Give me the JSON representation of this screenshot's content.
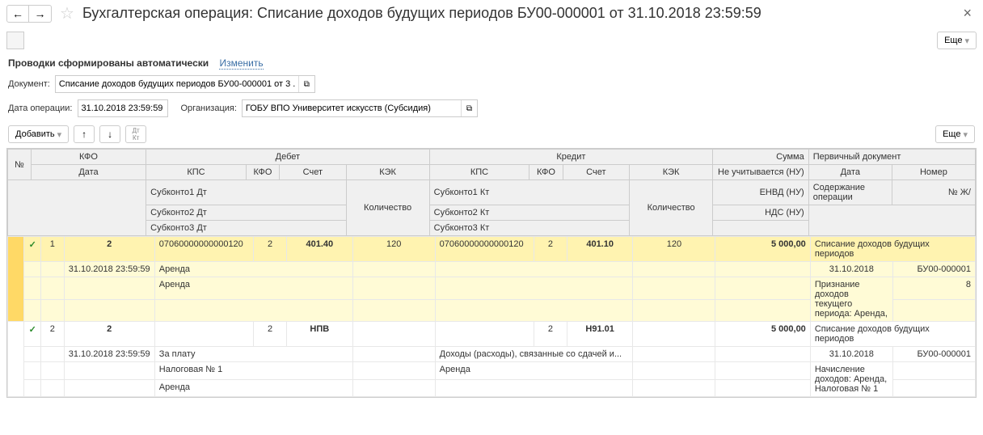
{
  "title": "Бухгалтерская операция: Списание доходов будущих периодов БУ00-000001 от 31.10.2018 23:59:59",
  "more_btn": "Еще",
  "autogen": {
    "text": "Проводки сформированы автоматически",
    "link": "Изменить"
  },
  "form": {
    "doc_label": "Документ:",
    "doc_value": "Списание доходов будущих периодов БУ00-000001 от 3 ...",
    "date_label": "Дата операции:",
    "date_value": "31.10.2018 23:59:59",
    "org_label": "Организация:",
    "org_value": "ГОБУ ВПО Университет искусств (Субсидия)"
  },
  "add_btn": "Добавить",
  "headers": {
    "num": "№",
    "kfo": "КФО",
    "date": "Дата",
    "debit": "Дебет",
    "credit": "Кредит",
    "sum": "Сумма",
    "prim": "Первичный документ",
    "kps": "КПС",
    "kfo2": "КФО",
    "account": "Счет",
    "kek": "КЭК",
    "nu": "Не учитывается (НУ)",
    "date2": "Дата",
    "number": "Номер",
    "sub1dt": "Субконто1 Дт",
    "sub2dt": "Субконто2 Дт",
    "sub3dt": "Субконто3 Дт",
    "qty": "Количество",
    "sub1kt": "Субконто1 Кт",
    "sub2kt": "Субконто2 Кт",
    "sub3kt": "Субконто3 Кт",
    "envd": "ЕНВД (НУ)",
    "nds": "НДС (НУ)",
    "content": "Содержание операции",
    "jn": "№ Ж/"
  },
  "rows": [
    {
      "num": "1",
      "kfo_main": "2",
      "date": "31.10.2018 23:59:59",
      "d_kps": "07060000000000120",
      "d_kfo": "2",
      "d_acc": "401.40",
      "d_kek": "120",
      "k_kps": "07060000000000120",
      "k_kfo": "2",
      "k_acc": "401.10",
      "k_kek": "120",
      "sum": "5 000,00",
      "prim": "Списание доходов будущих периодов",
      "sub1dt": "Аренда",
      "sub2dt": "Аренда",
      "sub1kt": "",
      "doc_date": "31.10.2018",
      "doc_num": "БУ00-000001",
      "content": "Признание доходов текущего периода: Аренда,",
      "jn": "8"
    },
    {
      "num": "2",
      "kfo_main": "2",
      "date": "31.10.2018 23:59:59",
      "d_kps": "",
      "d_kfo": "2",
      "d_acc": "НПВ",
      "d_kek": "",
      "k_kps": "",
      "k_kfo": "2",
      "k_acc": "Н91.01",
      "k_kek": "",
      "sum": "5 000,00",
      "prim": "Списание доходов будущих периодов",
      "sub1dt": "За плату",
      "sub2dt": "Налоговая № 1",
      "sub3dt": "Аренда",
      "sub1kt": "Доходы (расходы), связанные со сдачей и...",
      "sub2kt": "Аренда",
      "doc_date": "31.10.2018",
      "doc_num": "БУ00-000001",
      "content": "Начисление доходов: Аренда, Налоговая № 1",
      "jn": ""
    }
  ]
}
